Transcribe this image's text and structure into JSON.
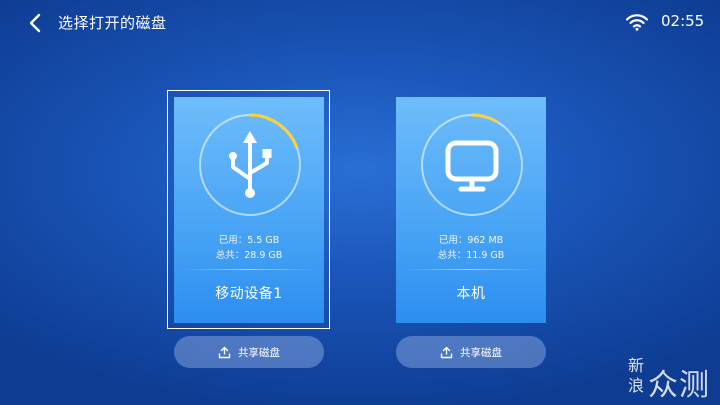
{
  "header": {
    "title": "选择打开的磁盘",
    "time": "02:55"
  },
  "drives": [
    {
      "name": "移动设备1",
      "used": "已用：5.5 GB",
      "total": "总共：28.9 GB",
      "usage_fraction": 0.19,
      "icon": "usb-icon",
      "selected": true,
      "share_label": "共享磁盘"
    },
    {
      "name": "本机",
      "used": "已用：962 MB",
      "total": "总共：11.9 GB",
      "usage_fraction": 0.08,
      "icon": "monitor-icon",
      "selected": false,
      "share_label": "共享磁盘"
    }
  ],
  "watermark": {
    "small": "新浪",
    "big": "众测"
  },
  "colors": {
    "accent_ring": "#ffd23c",
    "card_top": "#6fbdfb",
    "card_bottom": "#2d8ef0"
  }
}
